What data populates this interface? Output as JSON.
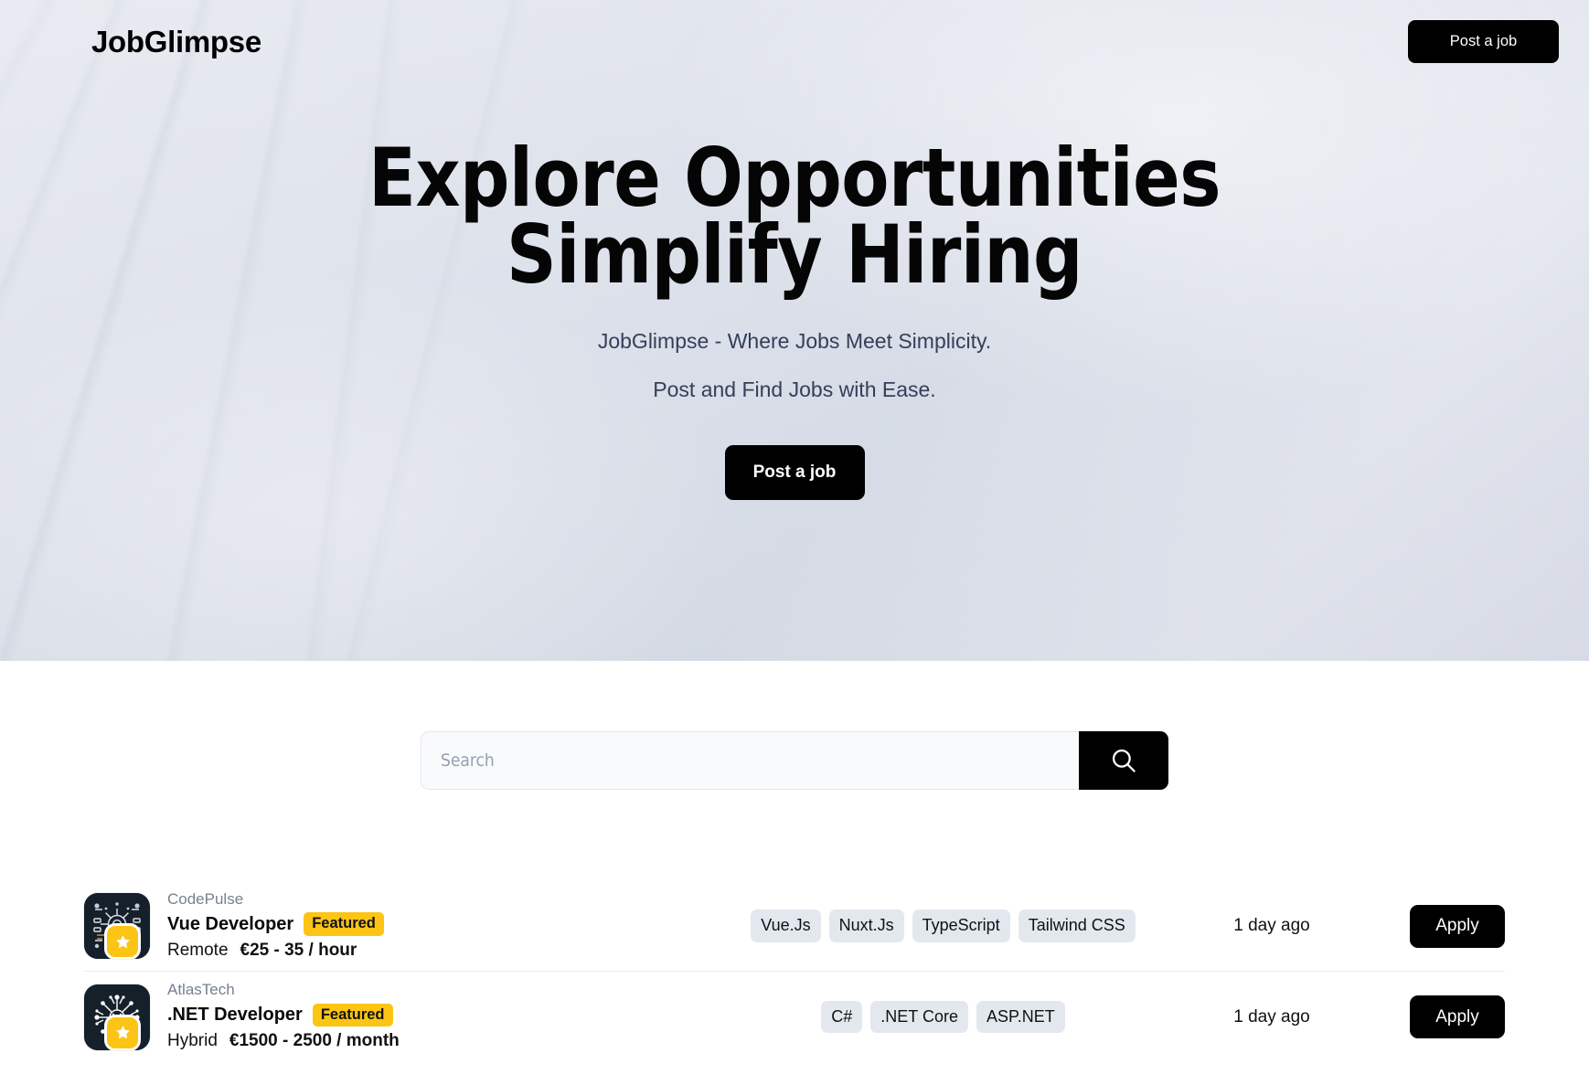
{
  "brand": "JobGlimpse",
  "nav": {
    "post_job_label": "Post a job"
  },
  "hero": {
    "title_line1": "Explore Opportunities",
    "title_line2": "Simplify Hiring",
    "tagline1": "JobGlimpse - Where Jobs Meet Simplicity.",
    "tagline2": "Post and Find Jobs with Ease.",
    "cta_label": "Post a job"
  },
  "search": {
    "placeholder": "Search",
    "value": "",
    "icon": "search-icon",
    "button_label": ""
  },
  "jobs": [
    {
      "company": "CodePulse",
      "title": "Vue Developer",
      "badge": "Featured",
      "location": "Remote",
      "salary": "€25 - 35 / hour",
      "tags": [
        "Vue.Js",
        "Nuxt.Js",
        "TypeScript",
        "Tailwind CSS"
      ],
      "age": "1 day ago",
      "apply_label": "Apply",
      "logo_icon": "circuit-chip-icon",
      "logo_badge_icon": "star-icon"
    },
    {
      "company": "AtlasTech",
      "title": ".NET Developer",
      "badge": "Featured",
      "location": "Hybrid",
      "salary": "€1500 - 2500 / month",
      "tags": [
        "C#",
        ".NET Core",
        "ASP.NET"
      ],
      "age": "1 day ago",
      "apply_label": "Apply",
      "logo_icon": "circuit-network-icon",
      "logo_badge_icon": "star-icon"
    }
  ],
  "colors": {
    "accent_yellow": "#fcc414",
    "dark": "#000000",
    "tag_bg": "#e3e8ef",
    "muted_text": "#77808e",
    "hero_bg": "#dfe3ec"
  }
}
